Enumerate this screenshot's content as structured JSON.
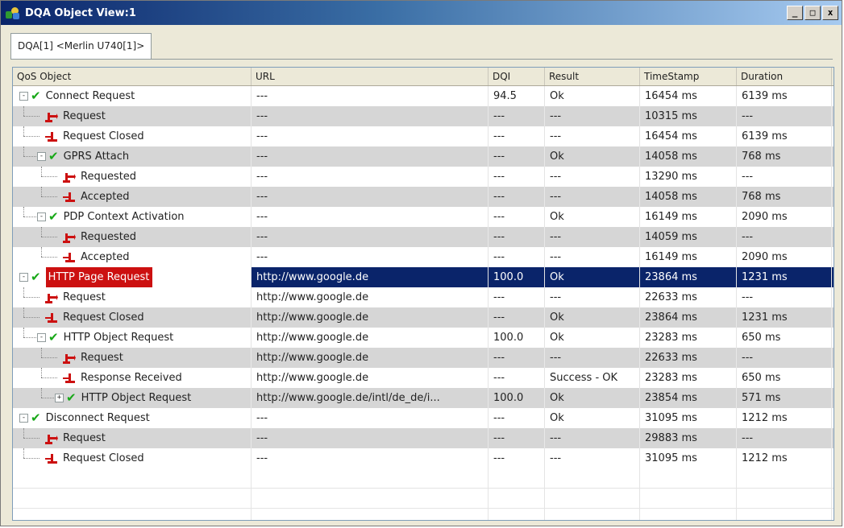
{
  "window": {
    "title": "DQA Object View:1",
    "controls": [
      "_",
      "□",
      "x"
    ]
  },
  "tab": {
    "label": "DQA[1] <Merlin U740[1]>"
  },
  "columns": [
    "QoS Object",
    "URL",
    "DQI",
    "Result",
    "TimeStamp",
    "Duration"
  ],
  "rows": [
    {
      "label": "Connect Request",
      "level": 0,
      "expander": "-",
      "icon": "check",
      "url": "---",
      "dqi": "94.5",
      "result": "Ok",
      "timestamp": "16454 ms",
      "duration": "6139 ms"
    },
    {
      "label": "Request",
      "level": 1,
      "icon": "arrow-request",
      "url": "---",
      "dqi": "---",
      "result": "---",
      "timestamp": "10315 ms",
      "duration": "---"
    },
    {
      "label": "Request Closed",
      "level": 1,
      "icon": "arrow-closed",
      "url": "---",
      "dqi": "---",
      "result": "---",
      "timestamp": "16454 ms",
      "duration": "6139 ms"
    },
    {
      "label": "GPRS Attach",
      "level": 1,
      "expander": "-",
      "icon": "check",
      "url": "---",
      "dqi": "---",
      "result": "Ok",
      "timestamp": "14058 ms",
      "duration": "768 ms"
    },
    {
      "label": "Requested",
      "level": 2,
      "icon": "arrow-request",
      "url": "---",
      "dqi": "---",
      "result": "---",
      "timestamp": "13290 ms",
      "duration": "---"
    },
    {
      "label": "Accepted",
      "level": 2,
      "icon": "arrow-closed",
      "url": "---",
      "dqi": "---",
      "result": "---",
      "timestamp": "14058 ms",
      "duration": "768 ms"
    },
    {
      "label": "PDP Context Activation",
      "level": 1,
      "expander": "-",
      "icon": "check",
      "url": "---",
      "dqi": "---",
      "result": "Ok",
      "timestamp": "16149 ms",
      "duration": "2090 ms"
    },
    {
      "label": "Requested",
      "level": 2,
      "icon": "arrow-request",
      "url": "---",
      "dqi": "---",
      "result": "---",
      "timestamp": "14059 ms",
      "duration": "---"
    },
    {
      "label": "Accepted",
      "level": 2,
      "icon": "arrow-closed",
      "url": "---",
      "dqi": "---",
      "result": "---",
      "timestamp": "16149 ms",
      "duration": "2090 ms"
    },
    {
      "label": "HTTP Page Request",
      "level": 0,
      "expander": "-",
      "icon": "check",
      "selected": true,
      "url": "http://www.google.de",
      "dqi": "100.0",
      "result": "Ok",
      "timestamp": "23864 ms",
      "duration": "1231 ms"
    },
    {
      "label": "Request",
      "level": 1,
      "icon": "arrow-request",
      "url": "http://www.google.de",
      "dqi": "---",
      "result": "---",
      "timestamp": "22633 ms",
      "duration": "---"
    },
    {
      "label": "Request Closed",
      "level": 1,
      "icon": "arrow-closed",
      "url": "http://www.google.de",
      "dqi": "---",
      "result": "Ok",
      "timestamp": "23864 ms",
      "duration": "1231 ms"
    },
    {
      "label": "HTTP Object Request",
      "level": 1,
      "expander": "-",
      "icon": "check",
      "url": "http://www.google.de",
      "dqi": "100.0",
      "result": "Ok",
      "timestamp": "23283 ms",
      "duration": "650 ms"
    },
    {
      "label": "Request",
      "level": 2,
      "icon": "arrow-request",
      "url": "http://www.google.de",
      "dqi": "---",
      "result": "---",
      "timestamp": "22633 ms",
      "duration": "---"
    },
    {
      "label": "Response Received",
      "level": 2,
      "icon": "arrow-closed",
      "url": "http://www.google.de",
      "dqi": "---",
      "result": "Success - OK",
      "timestamp": "23283 ms",
      "duration": "650 ms"
    },
    {
      "label": "HTTP Object Request",
      "level": 2,
      "expander": "+",
      "icon": "check",
      "url": "http://www.google.de/intl/de_de/i...",
      "dqi": "100.0",
      "result": "Ok",
      "timestamp": "23854 ms",
      "duration": "571 ms"
    },
    {
      "label": "Disconnect Request",
      "level": 0,
      "expander": "-",
      "icon": "check",
      "url": "---",
      "dqi": "---",
      "result": "Ok",
      "timestamp": "31095 ms",
      "duration": "1212 ms"
    },
    {
      "label": "Request",
      "level": 1,
      "icon": "arrow-request",
      "url": "---",
      "dqi": "---",
      "result": "---",
      "timestamp": "29883 ms",
      "duration": "---"
    },
    {
      "label": "Request Closed",
      "level": 1,
      "icon": "arrow-closed",
      "url": "---",
      "dqi": "---",
      "result": "---",
      "timestamp": "31095 ms",
      "duration": "1212 ms"
    }
  ],
  "colors": {
    "selection": "#0a246a",
    "highlight": "#cc1010",
    "check": "#18a818",
    "arrow": "#cc1010",
    "stripe": "#d6d6d6"
  }
}
